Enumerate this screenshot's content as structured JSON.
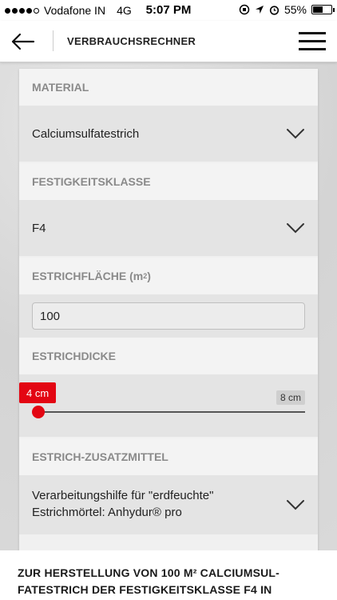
{
  "status_bar": {
    "carrier": "Vodafone IN",
    "network": "4G",
    "time": "5:07 PM",
    "battery": "55%",
    "battery_level": 0.55,
    "signal_bars": 4
  },
  "header": {
    "title": "VERBRAUCHSRECHNER"
  },
  "form": {
    "material": {
      "label": "MATERIAL",
      "value": "Calciumsulfatestrich"
    },
    "strength_class": {
      "label": "FESTIGKEITSKLASSE",
      "value": "F4"
    },
    "area": {
      "label_text": "ESTRICHFLÄCHE (m",
      "label_sup": "2",
      "label_close": ")",
      "value": "100"
    },
    "thickness": {
      "label": "ESTRICHDICKE",
      "current": "4 cm",
      "max": "8 cm",
      "fraction": 0
    },
    "additive": {
      "label": "ESTRICH-ZUSATZMITTEL",
      "line1": "Verarbeitungshilfe für \"erdfeuchte\"",
      "line2": "Estrichmörtel: Anhydur® pro"
    }
  },
  "result": {
    "text": "ZUR HERSTELLUNG VON 100 M² CALCIUMSUL-FATESTRICH DER FESTIGKEITSKLASSE F4 IN"
  },
  "colors": {
    "accent": "#e30613",
    "label": "#8a8a8a",
    "field_bg": "#e4e4e4"
  }
}
